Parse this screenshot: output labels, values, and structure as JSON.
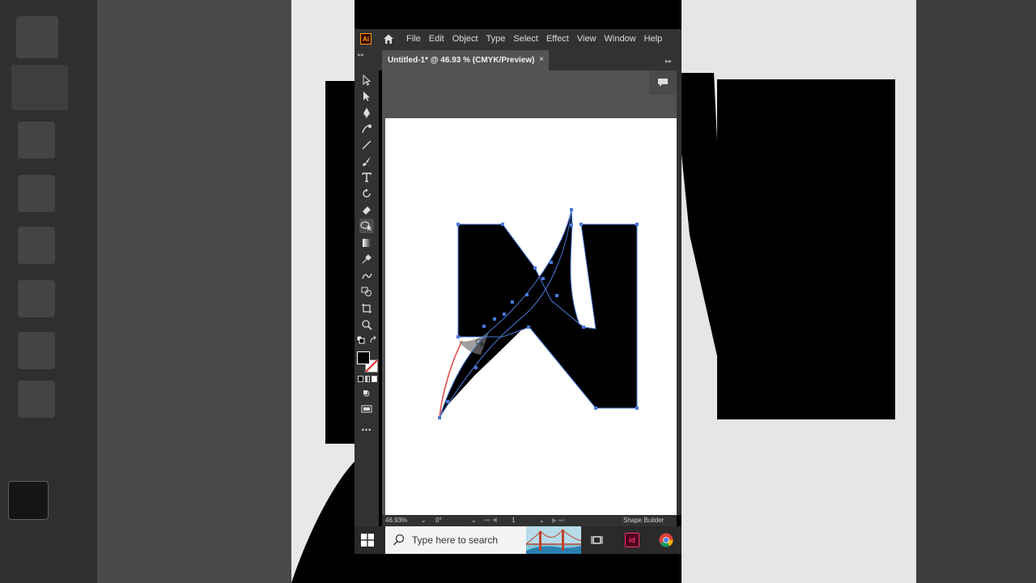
{
  "menubar": {
    "items": [
      "File",
      "Edit",
      "Object",
      "Type",
      "Select",
      "Effect",
      "View",
      "Window",
      "Help"
    ],
    "app_logo": "Ai"
  },
  "document_tab": {
    "title": "Untitled-1* @ 46.93 % (CMYK/Preview)",
    "close_glyph": "×"
  },
  "toolbar": {
    "tools": [
      "selection-tool",
      "direct-selection-tool",
      "pen-tool",
      "curvature-tool",
      "line-tool",
      "paintbrush-tool",
      "type-tool",
      "rotate-tool",
      "eraser-tool",
      "shape-builder-tool",
      "gradient-tool",
      "eyedropper-tool",
      "blend-tool",
      "symbol-sprayer-tool",
      "artboard-tool",
      "zoom-tool"
    ],
    "active_tool": "shape-builder-tool",
    "fill_color": "#000000",
    "stroke_color": "none",
    "more_glyph": "•••"
  },
  "statusbar": {
    "zoom": "46.93%",
    "rotation": "0°",
    "artboard_number": "1",
    "current_tool": "Shape Builder"
  },
  "taskbar": {
    "search_placeholder": "Type here to search",
    "apps": [
      "task-view",
      "indesign",
      "chrome"
    ],
    "indesign_label": "Id"
  },
  "colors": {
    "accent": "#4a78d8",
    "selection": "#4a78d8",
    "highlight": "#e05050",
    "panel": "#323232",
    "canvas": "#535353"
  }
}
